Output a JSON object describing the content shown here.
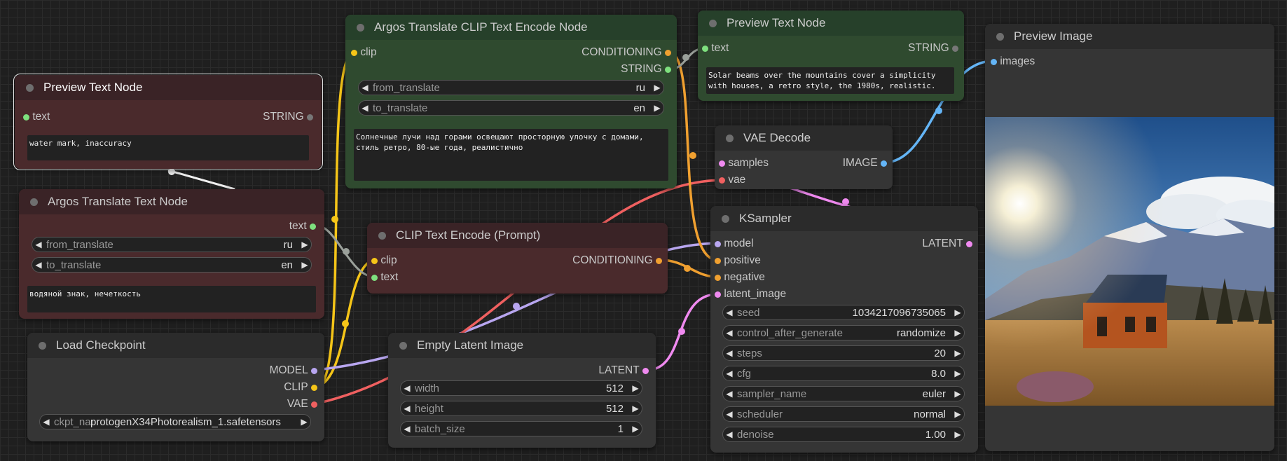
{
  "colors": {
    "clip": "#f5c518",
    "conditioning": "#f0a030",
    "string": "#7ee07e",
    "model": "#b8a6f0",
    "vae": "#f06060",
    "latent": "#f08af0",
    "image": "#64b5f6",
    "text_in": "#7ee07e"
  },
  "preview_text_1": {
    "title": "Preview Text Node",
    "in_text": "text",
    "out_string": "STRING",
    "content": "water mark, inaccuracy"
  },
  "argos_text": {
    "title": "Argos Translate Text Node",
    "out_text": "text",
    "from_label": "from_translate",
    "from_value": "ru",
    "to_label": "to_translate",
    "to_value": "en",
    "content": "водяной знак, нечеткость"
  },
  "load_checkpoint": {
    "title": "Load Checkpoint",
    "out_model": "MODEL",
    "out_clip": "CLIP",
    "out_vae": "VAE",
    "ckpt_label": "ckpt_name",
    "ckpt_value": "protogenX34Photorealism_1.safetensors"
  },
  "argos_clip": {
    "title": "Argos Translate CLIP Text Encode Node",
    "in_clip": "clip",
    "out_conditioning": "CONDITIONING",
    "out_string": "STRING",
    "from_label": "from_translate",
    "from_value": "ru",
    "to_label": "to_translate",
    "to_value": "en",
    "content": "Солнечные лучи над горами освещают просторную улочку с домами, стиль ретро, 80-ые года, реалистично"
  },
  "clip_encode": {
    "title": "CLIP Text Encode (Prompt)",
    "in_clip": "clip",
    "in_text": "text",
    "out_conditioning": "CONDITIONING"
  },
  "empty_latent": {
    "title": "Empty Latent Image",
    "out_latent": "LATENT",
    "width_label": "width",
    "width_value": "512",
    "height_label": "height",
    "height_value": "512",
    "batch_label": "batch_size",
    "batch_value": "1"
  },
  "preview_text_2": {
    "title": "Preview Text Node",
    "in_text": "text",
    "out_string": "STRING",
    "content": "Solar beams over the mountains cover a simplicity with houses, a retro style, the 1980s, realistic."
  },
  "vae_decode": {
    "title": "VAE Decode",
    "in_samples": "samples",
    "in_vae": "vae",
    "out_image": "IMAGE"
  },
  "ksampler": {
    "title": "KSampler",
    "in_model": "model",
    "in_positive": "positive",
    "in_negative": "negative",
    "in_latent": "latent_image",
    "out_latent": "LATENT",
    "widgets": [
      {
        "label": "seed",
        "value": "1034217096735065"
      },
      {
        "label": "control_after_generate",
        "value": "randomize"
      },
      {
        "label": "steps",
        "value": "20"
      },
      {
        "label": "cfg",
        "value": "8.0"
      },
      {
        "label": "sampler_name",
        "value": "euler"
      },
      {
        "label": "scheduler",
        "value": "normal"
      },
      {
        "label": "denoise",
        "value": "1.00"
      }
    ]
  },
  "preview_image": {
    "title": "Preview Image",
    "in_images": "images"
  }
}
